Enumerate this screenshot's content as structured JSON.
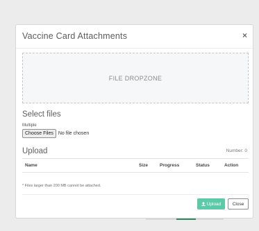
{
  "modal": {
    "title": "Vaccine Card Attachments",
    "close_symbol": "×"
  },
  "dropzone": {
    "label": "FILE DROPZONE"
  },
  "select_files": {
    "heading": "Select files",
    "multiple_label": "Multiple",
    "choose_button": "Choose Files",
    "no_file_text": "No file chosen"
  },
  "upload": {
    "heading": "Upload",
    "number_label": "Number: 0",
    "columns": [
      "Name",
      "Size",
      "Progress",
      "Status",
      "Action"
    ],
    "note": "* Files larger than 200 MB cannot be attached."
  },
  "footer": {
    "upload_button": "Upload",
    "close_button": "Close"
  },
  "colors": {
    "upload_button_bg": "#5cc9a7",
    "dropzone_bg": "#f6f7f9"
  },
  "icons": {
    "upload": "upload-icon",
    "close": "close-icon"
  }
}
